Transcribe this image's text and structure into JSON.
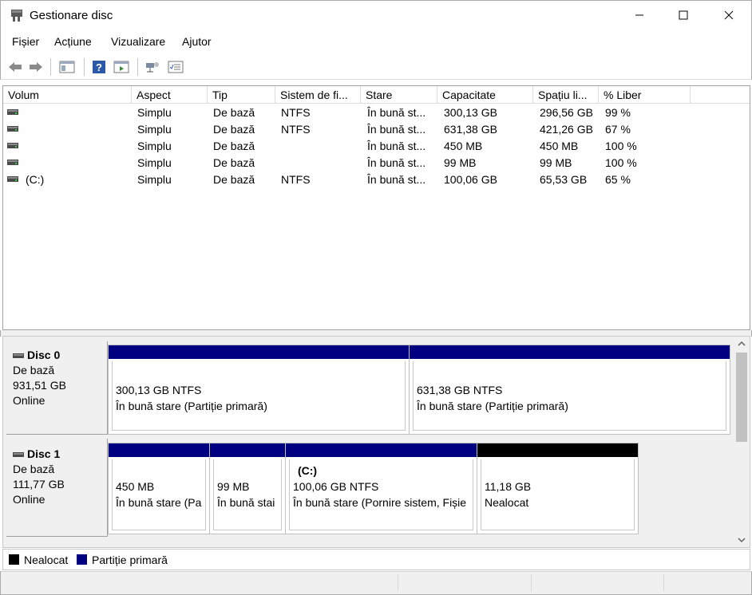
{
  "window": {
    "title": "Gestionare disc"
  },
  "menu": [
    "Fișier",
    "Acțiune",
    "Vizualizare",
    "Ajutor"
  ],
  "columns": [
    "Volum",
    "Aspect",
    "Tip",
    "Sistem de fi...",
    "Stare",
    "Capacitate",
    "Spațiu li...",
    "% Liber"
  ],
  "volumes": [
    {
      "volum": "",
      "aspect": "Simplu",
      "tip": "De bază",
      "fs": "NTFS",
      "stare": "În bună st...",
      "capacitate": "300,13 GB",
      "liber": "296,56 GB",
      "procent": "99 %"
    },
    {
      "volum": "",
      "aspect": "Simplu",
      "tip": "De bază",
      "fs": "NTFS",
      "stare": "În bună st...",
      "capacitate": "631,38 GB",
      "liber": "421,26 GB",
      "procent": "67 %"
    },
    {
      "volum": "",
      "aspect": "Simplu",
      "tip": "De bază",
      "fs": "",
      "stare": "În bună st...",
      "capacitate": "450 MB",
      "liber": "450 MB",
      "procent": "100 %"
    },
    {
      "volum": "",
      "aspect": "Simplu",
      "tip": "De bază",
      "fs": "",
      "stare": "În bună st...",
      "capacitate": "99 MB",
      "liber": "99 MB",
      "procent": "100 %"
    },
    {
      "volum": "(C:)",
      "aspect": "Simplu",
      "tip": "De bază",
      "fs": "NTFS",
      "stare": "În bună st...",
      "capacitate": "100,06 GB",
      "liber": "65,53 GB",
      "procent": "65 %"
    }
  ],
  "disks": [
    {
      "name": "Disc 0",
      "type": "De bază",
      "size": "931,51 GB",
      "status": "Online",
      "partitions": [
        {
          "title": "",
          "line1": "300,13 GB NTFS",
          "line2": "În bună stare (Partiție primară)"
        },
        {
          "title": "",
          "line1": "631,38 GB NTFS",
          "line2": "În bună stare (Partiție primară)"
        }
      ]
    },
    {
      "name": "Disc 1",
      "type": "De bază",
      "size": "111,77 GB",
      "status": "Online",
      "partitions": [
        {
          "title": "",
          "line1": "450 MB",
          "line2": "În bună stare (Pa"
        },
        {
          "title": "",
          "line1": "99 MB",
          "line2": "În bună stai"
        },
        {
          "title": "(C:)",
          "line1": "100,06 GB NTFS",
          "line2": "În bună stare (Pornire sistem, Fișie"
        },
        {
          "title": "",
          "line1": "11,18 GB",
          "line2": "Nealocat"
        }
      ]
    }
  ],
  "legend": [
    {
      "label": "Nealocat",
      "color": "#000000"
    },
    {
      "label": "Partiție primară",
      "color": "#000080"
    }
  ]
}
